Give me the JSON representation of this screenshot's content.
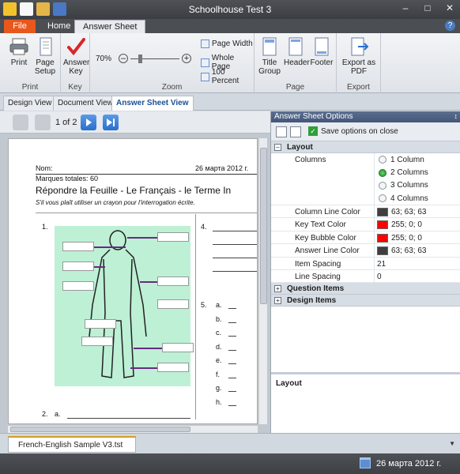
{
  "window": {
    "title": "Schoolhouse Test 3"
  },
  "ribbon_tabs": [
    "File",
    "Home",
    "Answer Sheet"
  ],
  "ribbon": {
    "print": {
      "print_label": "Print",
      "page_setup_label": "Page Setup",
      "group_label": "Print"
    },
    "key": {
      "answer_key_label": "Answer Key",
      "group_label": "Key"
    },
    "zoom": {
      "percent": "70%",
      "page_width": "Page Width",
      "whole_page": "Whole Page",
      "hundred_percent": "100 Percent",
      "group_label": "Zoom"
    },
    "page": {
      "title_group": "Title Group",
      "header": "Header",
      "footer": "Footer",
      "group_label": "Page"
    },
    "export": {
      "export_pdf": "Export as PDF",
      "group_label": "Export"
    }
  },
  "view_tabs": [
    "Design View",
    "Document View",
    "Answer Sheet View"
  ],
  "nav": {
    "page_indicator": "1 of 2"
  },
  "page": {
    "name_label": "Nom:",
    "date": "26 марта 2012 г.",
    "total_points": "Marques totales: 60",
    "title": "Répondre la Feuille - Le Français - le Terme In",
    "instructions": "S'il vous plaît utiliser un crayon pour l'interrogation écrite.",
    "q1": "1.",
    "q2": "2.",
    "q2_a": "a.",
    "q4": "4.",
    "q5": "5.",
    "q5_choices": [
      "a.",
      "b.",
      "c.",
      "d.",
      "e.",
      "f.",
      "g.",
      "h."
    ]
  },
  "options_panel": {
    "title": "Answer Sheet Options",
    "pin": "↕",
    "save_on_close": "Save options on close",
    "categories": {
      "layout": "Layout",
      "question_items": "Question Items",
      "design_items": "Design Items"
    },
    "columns_label": "Columns",
    "column_options": [
      "1 Column",
      "2 Columns",
      "3 Columns",
      "4 Columns"
    ],
    "selected_column_index": 1,
    "properties": [
      {
        "name": "Column Line Color",
        "value": "63; 63; 63",
        "color": "#3f3f3f"
      },
      {
        "name": "Key Text Color",
        "value": "255; 0; 0",
        "color": "#ff0000"
      },
      {
        "name": "Key Bubble Color",
        "value": "255; 0; 0",
        "color": "#ff0000"
      },
      {
        "name": "Answer Line Color",
        "value": "63; 63; 63",
        "color": "#3f3f3f"
      },
      {
        "name": "Item Spacing",
        "value": "21"
      },
      {
        "name": "Line Spacing",
        "value": "0"
      }
    ],
    "description_title": "Layout"
  },
  "document_tab": {
    "label": "French-English Sample V3.tst"
  },
  "status": {
    "date": "26 марта 2012 г."
  },
  "colors": {
    "accent_file": "#e8581c",
    "nav_enabled": "#2a6fcf",
    "illustration_bg": "#bdf0d5"
  },
  "icons": [
    "print-icon",
    "page-setup-icon",
    "answer-key-checkmark-icon",
    "zoom-slider",
    "title-group-icon",
    "header-icon",
    "footer-icon",
    "export-pdf-icon",
    "calendar-icon"
  ]
}
